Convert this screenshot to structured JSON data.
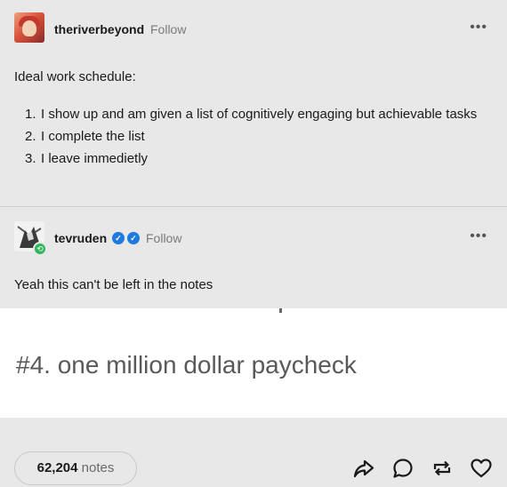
{
  "post": {
    "author": "theriverbeyond",
    "follow_label": "Follow",
    "more_label": "•••",
    "intro": "Ideal work schedule:",
    "items": [
      {
        "num": "1.",
        "text": "I show up and am given a list of cognitively engaging but achievable tasks"
      },
      {
        "num": "2.",
        "text": "I complete the list"
      },
      {
        "num": "3.",
        "text": "I leave immedietly"
      }
    ]
  },
  "reblog": {
    "author": "tevruden",
    "follow_label": "Follow",
    "more_label": "•••",
    "comment": "Yeah this can't be left in the notes",
    "image_text": "#4. one million dollar paycheck"
  },
  "footer": {
    "notes_count": "62,204",
    "notes_label": "notes",
    "actions": [
      "share-icon",
      "reply-icon",
      "reblog-icon",
      "like-icon"
    ]
  },
  "colors": {
    "background": "#e8e8e8",
    "verified_badge": "#1f7ae0",
    "reblog_badge": "#2fb55a"
  }
}
